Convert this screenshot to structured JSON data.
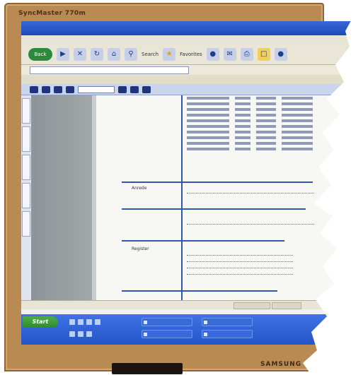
{
  "monitor": {
    "brand": "SyncMaster 770m",
    "logo": "SAMSUNG"
  },
  "browser": {
    "title": "",
    "menu": [],
    "toolbar": {
      "back_label": "Back",
      "search_label": "Search",
      "favorites_label": "Favorites"
    },
    "address_label": "",
    "address_value": "",
    "links": []
  },
  "document": {
    "sections": [
      {
        "label": "Anrede"
      },
      {
        "label": ""
      },
      {
        "label": "Register"
      },
      {
        "label": ""
      }
    ]
  },
  "taskbar": {
    "start_label": "Start",
    "tasks": []
  },
  "colors": {
    "bezel": "#b98a52",
    "rule": "#2d57b0",
    "taskbar": "#2455c9",
    "start": "#3f9a3a"
  }
}
